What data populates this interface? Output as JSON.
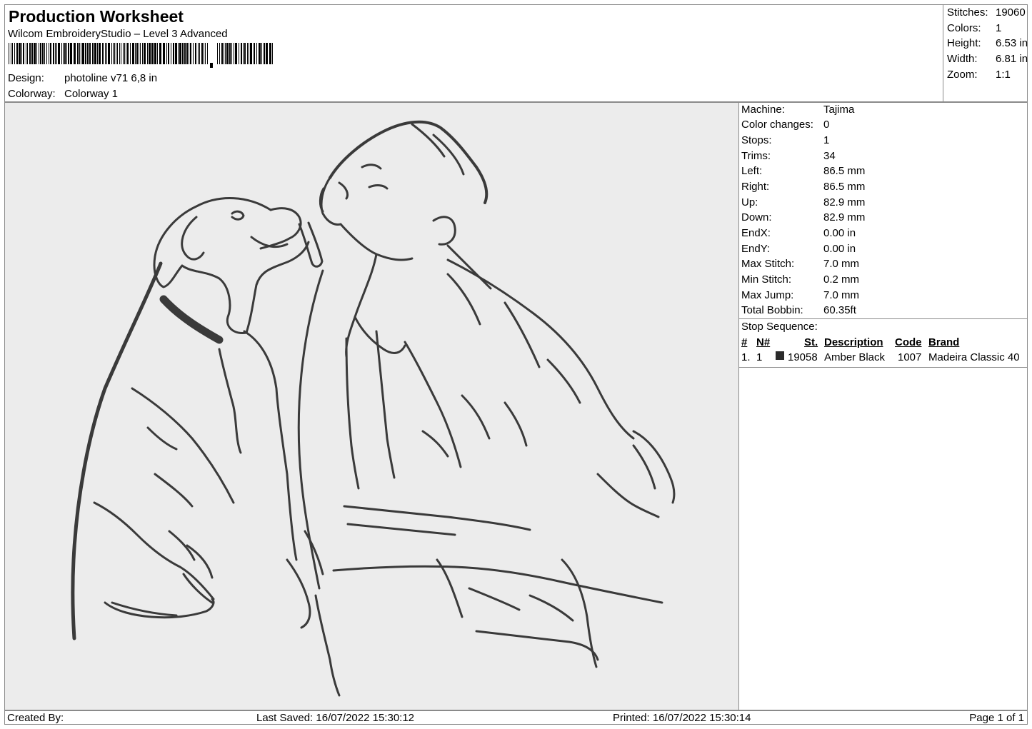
{
  "header": {
    "title": "Production Worksheet",
    "software": "Wilcom EmbroideryStudio – Level 3 Advanced",
    "design_label": "Design:",
    "design_value": "photoline v71 6,8 in",
    "colorway_label": "Colorway:",
    "colorway_value": "Colorway 1"
  },
  "summary": {
    "stitches_label": "Stitches:",
    "stitches": "19060",
    "colors_label": "Colors:",
    "colors": "1",
    "height_label": "Height:",
    "height": "6.53 in",
    "width_label": "Width:",
    "width": "6.81 in",
    "zoom_label": "Zoom:",
    "zoom": "1:1"
  },
  "stats": {
    "machine_label": "Machine:",
    "machine": "Tajima",
    "color_changes_label": "Color changes:",
    "color_changes": "0",
    "stops_label": "Stops:",
    "stops": "1",
    "trims_label": "Trims:",
    "trims": "34",
    "left_label": "Left:",
    "left": "86.5 mm",
    "right_label": "Right:",
    "right": "86.5 mm",
    "up_label": "Up:",
    "up": "82.9 mm",
    "down_label": "Down:",
    "down": "82.9 mm",
    "endx_label": "EndX:",
    "endx": "0.00 in",
    "endy_label": "EndY:",
    "endy": "0.00 in",
    "max_stitch_label": "Max Stitch:",
    "max_stitch": "7.0 mm",
    "min_stitch_label": "Min Stitch:",
    "min_stitch": "0.2 mm",
    "max_jump_label": "Max Jump:",
    "max_jump": "7.0 mm",
    "total_bobbin_label": "Total Bobbin:",
    "total_bobbin": "60.35ft"
  },
  "stop_sequence": {
    "title": "Stop Sequence:",
    "headers": {
      "num": "#",
      "n": "N#",
      "st": "St.",
      "description": "Description",
      "code": "Code",
      "brand": "Brand"
    },
    "rows": [
      {
        "num": "1.",
        "n": "1",
        "st": "19058",
        "description": "Amber Black",
        "code": "1007",
        "brand": "Madeira Classic 40",
        "color": "#2a2a2a"
      }
    ]
  },
  "footer": {
    "created_by": "Created By:",
    "last_saved": "Last Saved: 16/07/2022 15:30:12",
    "printed": "Printed: 16/07/2022 15:30:14",
    "page": "Page 1 of 1"
  },
  "colors": {
    "thread": "#3a3a3a",
    "canvas_bg": "#ececec",
    "border": "#8a8a8a"
  }
}
